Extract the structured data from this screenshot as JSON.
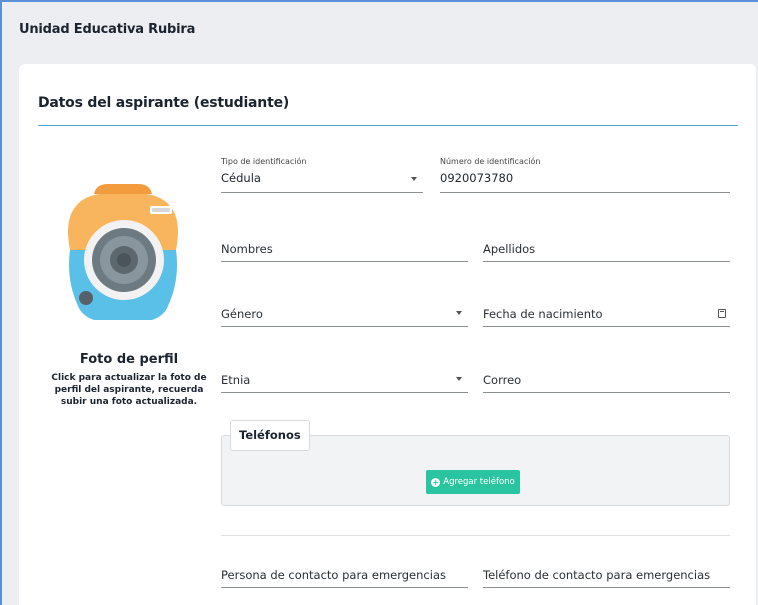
{
  "app": {
    "title": "Unidad Educativa Rubira"
  },
  "section": {
    "title": "Datos del aspirante (estudiante)"
  },
  "photo": {
    "title": "Foto de perfil",
    "hint": "Click para actualizar la foto de perfil del aspirante, recuerda subir una foto actualizada.",
    "icon": "camera-icon"
  },
  "form": {
    "id_type": {
      "label": "Tipo de identificación",
      "value": "Cédula"
    },
    "id_number": {
      "label": "Número de identificación",
      "value": "0920073780"
    },
    "first_names": {
      "label": "Nombres",
      "value": ""
    },
    "last_names": {
      "label": "Apellidos",
      "value": ""
    },
    "gender": {
      "label": "Género",
      "value": ""
    },
    "birth_date": {
      "label": "Fecha de nacimiento",
      "value": ""
    },
    "ethnicity": {
      "label": "Etnia",
      "value": ""
    },
    "email": {
      "label": "Correo",
      "value": ""
    },
    "emergency_contact": {
      "label": "Persona de contacto para emergencias",
      "value": ""
    },
    "emergency_phone": {
      "label": "Teléfono de contacto para emergencias",
      "value": ""
    }
  },
  "phones": {
    "legend": "Teléfonos",
    "add_button": "Agregar teléfono"
  },
  "colors": {
    "accent_line": "#4aa7c9",
    "button_green": "#2bc4a0",
    "camera_orange": "#f9b55e",
    "camera_blue": "#5bc0e8"
  }
}
